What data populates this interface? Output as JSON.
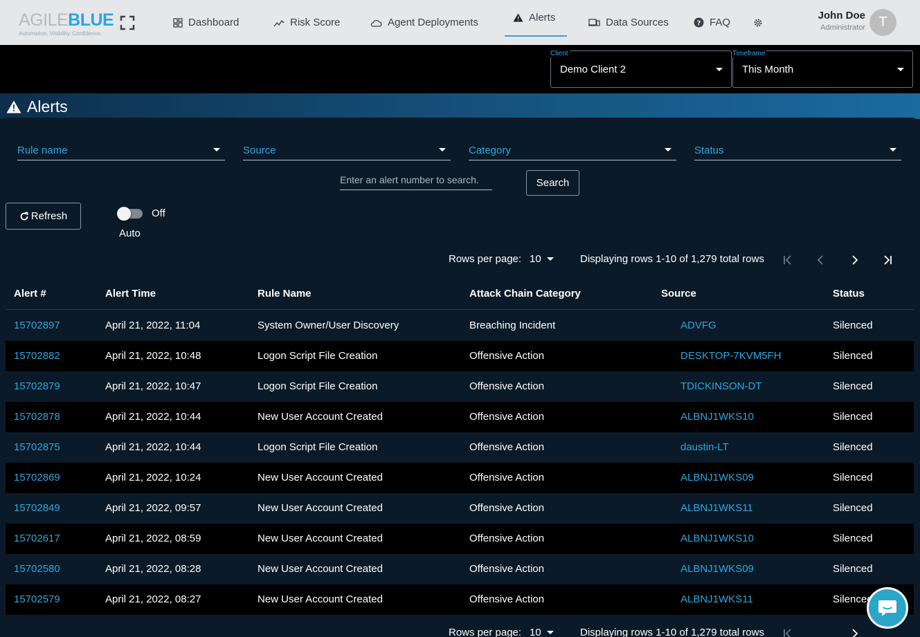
{
  "brand": {
    "agile": "AGILE",
    "blue": "BLUE",
    "tagline": "Automation. Visibility. Confidence."
  },
  "nav": {
    "items": [
      {
        "label": "Dashboard",
        "icon": "dashboard-icon"
      },
      {
        "label": "Risk Score",
        "icon": "trend-icon"
      },
      {
        "label": "Agent Deployments",
        "icon": "cloud-icon"
      },
      {
        "label": "Alerts",
        "icon": "warning-icon",
        "active": true
      },
      {
        "label": "Data Sources",
        "icon": "devices-icon"
      },
      {
        "label": "FAQ",
        "icon": "help-icon"
      }
    ]
  },
  "user": {
    "name": "John Doe",
    "role": "Administrator",
    "initial": "T"
  },
  "filters": {
    "client": {
      "label": "Client",
      "value": "Demo Client 2"
    },
    "timeframe": {
      "label": "Timeframe",
      "value": "This Month"
    }
  },
  "page": {
    "title": "Alerts"
  },
  "search": {
    "rule_name": "Rule name",
    "source": "Source",
    "category": "Category",
    "status": "Status",
    "alert_placeholder": "Enter an alert number to search.",
    "search_label": "Search"
  },
  "controls": {
    "refresh_label": "Refresh",
    "auto_state": "Off",
    "auto_label": "Auto"
  },
  "pagination": {
    "rows_per_page_label": "Rows per page:",
    "rows_per_page": "10",
    "display_text": "Displaying rows 1-10 of 1,279 total rows"
  },
  "table": {
    "columns": [
      "Alert #",
      "Alert Time",
      "Rule Name",
      "Attack Chain Category",
      "Source",
      "Status"
    ],
    "rows": [
      [
        "15702897",
        "April 21, 2022, 11:04",
        "System Owner/User Discovery",
        "Breaching Incident",
        "ADVFG",
        "Silenced"
      ],
      [
        "15702882",
        "April 21, 2022, 10:48",
        "Logon Script File Creation",
        "Offensive Action",
        "DESKTOP-7KVM5FH",
        "Silenced"
      ],
      [
        "15702879",
        "April 21, 2022, 10:47",
        "Logon Script File Creation",
        "Offensive Action",
        "TDICKINSON-DT",
        "Silenced"
      ],
      [
        "15702878",
        "April 21, 2022, 10:44",
        "New User Account Created",
        "Offensive Action",
        "ALBNJ1WKS10",
        "Silenced"
      ],
      [
        "15702875",
        "April 21, 2022, 10:44",
        "Logon Script File Creation",
        "Offensive Action",
        "daustin-LT",
        "Silenced"
      ],
      [
        "15702869",
        "April 21, 2022, 10:24",
        "New User Account Created",
        "Offensive Action",
        "ALBNJ1WKS09",
        "Silenced"
      ],
      [
        "15702849",
        "April 21, 2022, 09:57",
        "New User Account Created",
        "Offensive Action",
        "ALBNJ1WKS11",
        "Silenced"
      ],
      [
        "15702617",
        "April 21, 2022, 08:59",
        "New User Account Created",
        "Offensive Action",
        "ALBNJ1WKS10",
        "Silenced"
      ],
      [
        "15702580",
        "April 21, 2022, 08:28",
        "New User Account Created",
        "Offensive Action",
        "ALBNJ1WKS09",
        "Silenced"
      ],
      [
        "15702579",
        "April 21, 2022, 08:27",
        "New User Account Created",
        "Offensive Action",
        "ALBNJ1WKS11",
        "Silenced"
      ]
    ]
  },
  "colors": {
    "accent": "#2ba6de",
    "background": "#0b1a28",
    "stripe": "#000000"
  }
}
